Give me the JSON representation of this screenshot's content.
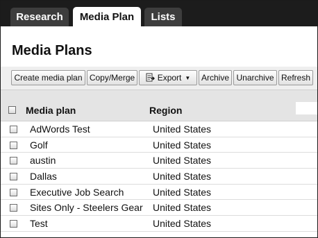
{
  "tabs": [
    {
      "label": "Research",
      "active": false
    },
    {
      "label": "Media Plan",
      "active": true
    },
    {
      "label": "Lists",
      "active": false
    }
  ],
  "page_title": "Media Plans",
  "toolbar": {
    "create_label": "Create media plan",
    "copy_label": "Copy/Merge",
    "export_label": "Export",
    "export_icon": "export-icon",
    "archive_label": "Archive",
    "unarchive_label": "Unarchive",
    "refresh_label": "Refresh"
  },
  "table": {
    "columns": [
      "Media plan",
      "Region"
    ],
    "rows": [
      {
        "name": "AdWords Test",
        "region": "United States"
      },
      {
        "name": "Golf",
        "region": "United States"
      },
      {
        "name": "austin",
        "region": "United States"
      },
      {
        "name": "Dallas",
        "region": "United States"
      },
      {
        "name": "Executive Job Search",
        "region": "United States"
      },
      {
        "name": "Sites Only - Steelers Gear",
        "region": "United States"
      },
      {
        "name": "Test",
        "region": "United States"
      }
    ]
  },
  "colors": {
    "tabbar_bg": "#1c1c1c",
    "tab_inactive_bg": "#3d3d3d",
    "toolbar_bg": "#efefef",
    "header_bg": "#e4e4e4"
  }
}
